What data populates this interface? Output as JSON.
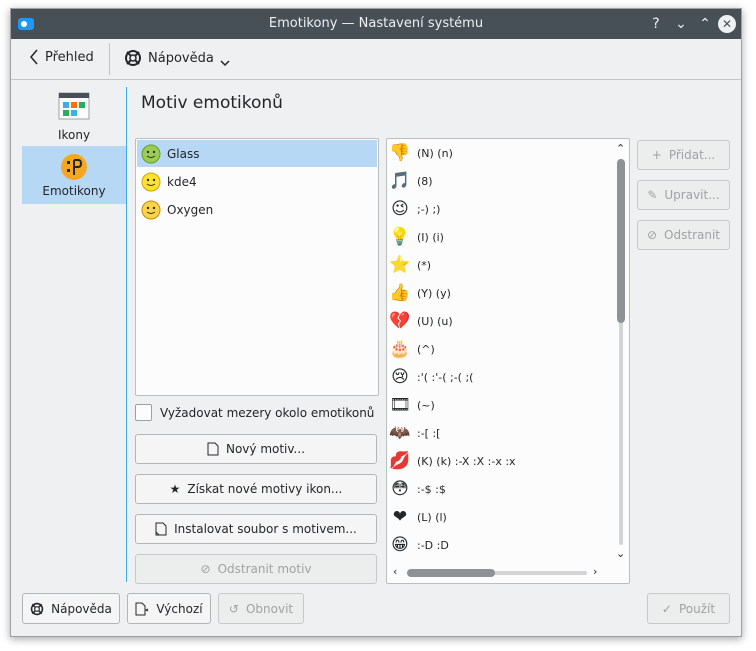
{
  "window": {
    "title": "Emotikony  — Nastavení systému"
  },
  "titlebar_buttons": [
    "?",
    "⌄",
    "⌃",
    "✕"
  ],
  "toolbar": {
    "back_label": "Přehled",
    "help_label": "Nápověda"
  },
  "sidebar": {
    "items": [
      {
        "label": "Ikony"
      },
      {
        "label": "Emotikony"
      }
    ]
  },
  "main": {
    "title": "Motiv emotikonů",
    "themes": [
      {
        "label": "Glass"
      },
      {
        "label": "kde4"
      },
      {
        "label": "Oxygen"
      }
    ],
    "selected_theme": "Glass",
    "require_spaces_label": "Vyžadovat mezery okolo emotikonů",
    "new_theme_label": "Nový motiv...",
    "get_new_label": "Získat nové motivy ikon...",
    "install_label": "Instalovat soubor s motivem...",
    "remove_theme_label": "Odstranit motiv",
    "emoticons": [
      {
        "text": "(N) (n)",
        "glyph": "👎"
      },
      {
        "text": "(8)",
        "glyph": "🎵"
      },
      {
        "text": ";-) ;)",
        "glyph": "😉"
      },
      {
        "text": "(I) (i)",
        "glyph": "💡"
      },
      {
        "text": "(*)",
        "glyph": "⭐"
      },
      {
        "text": "(Y) (y)",
        "glyph": "👍"
      },
      {
        "text": "(U) (u)",
        "glyph": "💔"
      },
      {
        "text": "(^)",
        "glyph": "🎂"
      },
      {
        "text": ":'( :'-( ;-( ;(",
        "glyph": "😢"
      },
      {
        "text": "(~)",
        "glyph": "🎞"
      },
      {
        "text": ":-[ :[",
        "glyph": "🦇"
      },
      {
        "text": "(K) (k) :-X :X :-x :x",
        "glyph": "💋"
      },
      {
        "text": ":-$ :$",
        "glyph": "😳"
      },
      {
        "text": "(L) (l)",
        "glyph": "❤"
      },
      {
        "text": ":-D :D",
        "glyph": "😁"
      }
    ],
    "add_label": "Přidat...",
    "edit_label": "Upravit...",
    "remove_label": "Odstranit"
  },
  "footer": {
    "help_label": "Nápověda",
    "defaults_label": "Výchozí",
    "reset_label": "Obnovit",
    "apply_label": "Použít"
  },
  "colors": {
    "titlebar": "#475057",
    "selection": "#b7d8f5",
    "accent": "#3daee9"
  }
}
